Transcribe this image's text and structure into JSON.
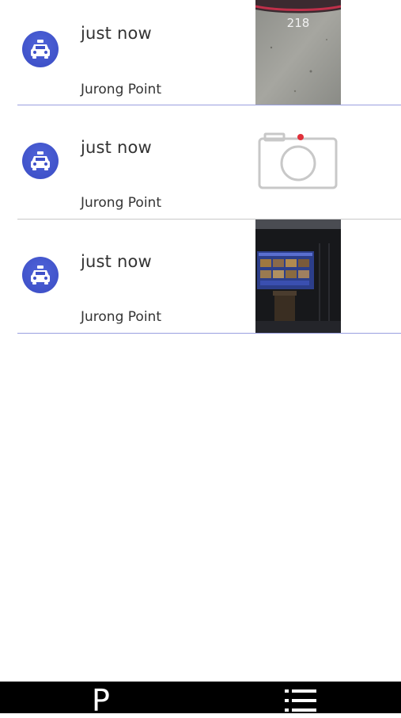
{
  "records": [
    {
      "time": "just now",
      "location": "Jurong Point",
      "thumbnail": "photo-parking-lot",
      "thumb_label": "218"
    },
    {
      "time": "just now",
      "location": "Jurong Point",
      "thumbnail": "camera-placeholder-icon"
    },
    {
      "time": "just now",
      "location": "Jurong Point",
      "thumbnail": "photo-display-screen"
    }
  ],
  "tabbar": {
    "left_tab_label": "P",
    "right_tab_icon": "list-icon"
  },
  "colors": {
    "avatar": "#3f51c9",
    "divider": "#9aa0e0",
    "tabbar": "#000000"
  }
}
